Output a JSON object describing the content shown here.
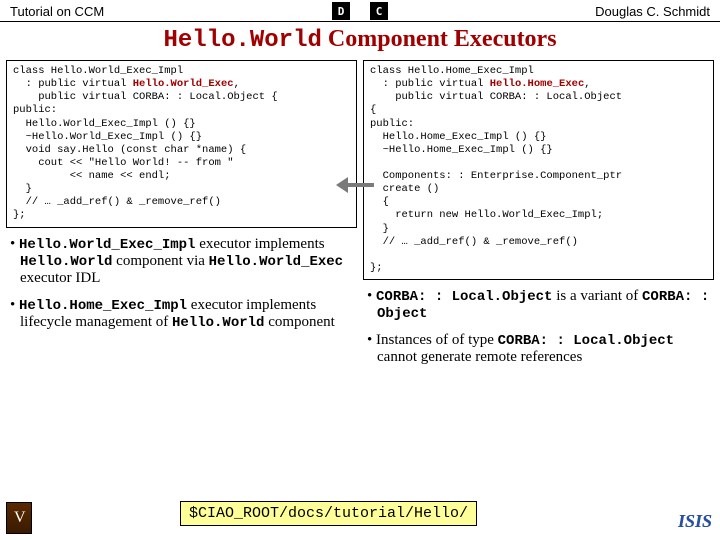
{
  "header": {
    "left": "Tutorial on CCM",
    "right": "Douglas C. Schmidt"
  },
  "title_mono": "Hello.World",
  "title_rest": " Component Executors",
  "code_left_pre": "class Hello.World_Exec_Impl\n  : public virtual ",
  "code_left_hl": "Hello.World_Exec",
  "code_left_post": ",\n    public virtual CORBA: : Local.Object {\npublic:\n  Hello.World_Exec_Impl () {}\n  ~Hello.World_Exec_Impl () {}\n  void say.Hello (const char *name) {\n    cout << \"Hello World! -- from \"\n         << name << endl;\n  }\n  // … _add_ref() & _remove_ref()\n};",
  "code_right_pre": "class Hello.Home_Exec_Impl\n  : public virtual ",
  "code_right_hl": "Hello.Home_Exec",
  "code_right_post": ",\n    public virtual CORBA: : Local.Object\n{\npublic:\n  Hello.Home_Exec_Impl () {}\n  ~Hello.Home_Exec_Impl () {}\n\n  Components: : Enterprise.Component_ptr\n  create ()\n  {\n    return new Hello.World_Exec_Impl;\n  }\n  // … _add_ref() & _remove_ref()\n\n};",
  "left_bullets": {
    "b1": {
      "m1": "Hello.World_Exec_Impl",
      "t1": " executor implements ",
      "m2": "Hello.World",
      "t2": " component via ",
      "m3": "Hello.World_Exec",
      "t3": " executor IDL"
    },
    "b2": {
      "m1": "Hello.Home_Exec_Impl",
      "t1": " executor implements lifecycle management of ",
      "m2": "Hello.World",
      "t2": " component"
    }
  },
  "right_bullets": {
    "b1": {
      "m1": "CORBA: : Local.Object",
      "t1": " is a variant of ",
      "m2": "CORBA: : Object"
    },
    "b2": {
      "t0": "Instances of of type ",
      "m1": "CORBA: : Local.Object",
      "t1": " cannot generate remote references"
    }
  },
  "path": "$CIAO_ROOT/docs/tutorial/Hello/",
  "footer_right": "ISIS"
}
